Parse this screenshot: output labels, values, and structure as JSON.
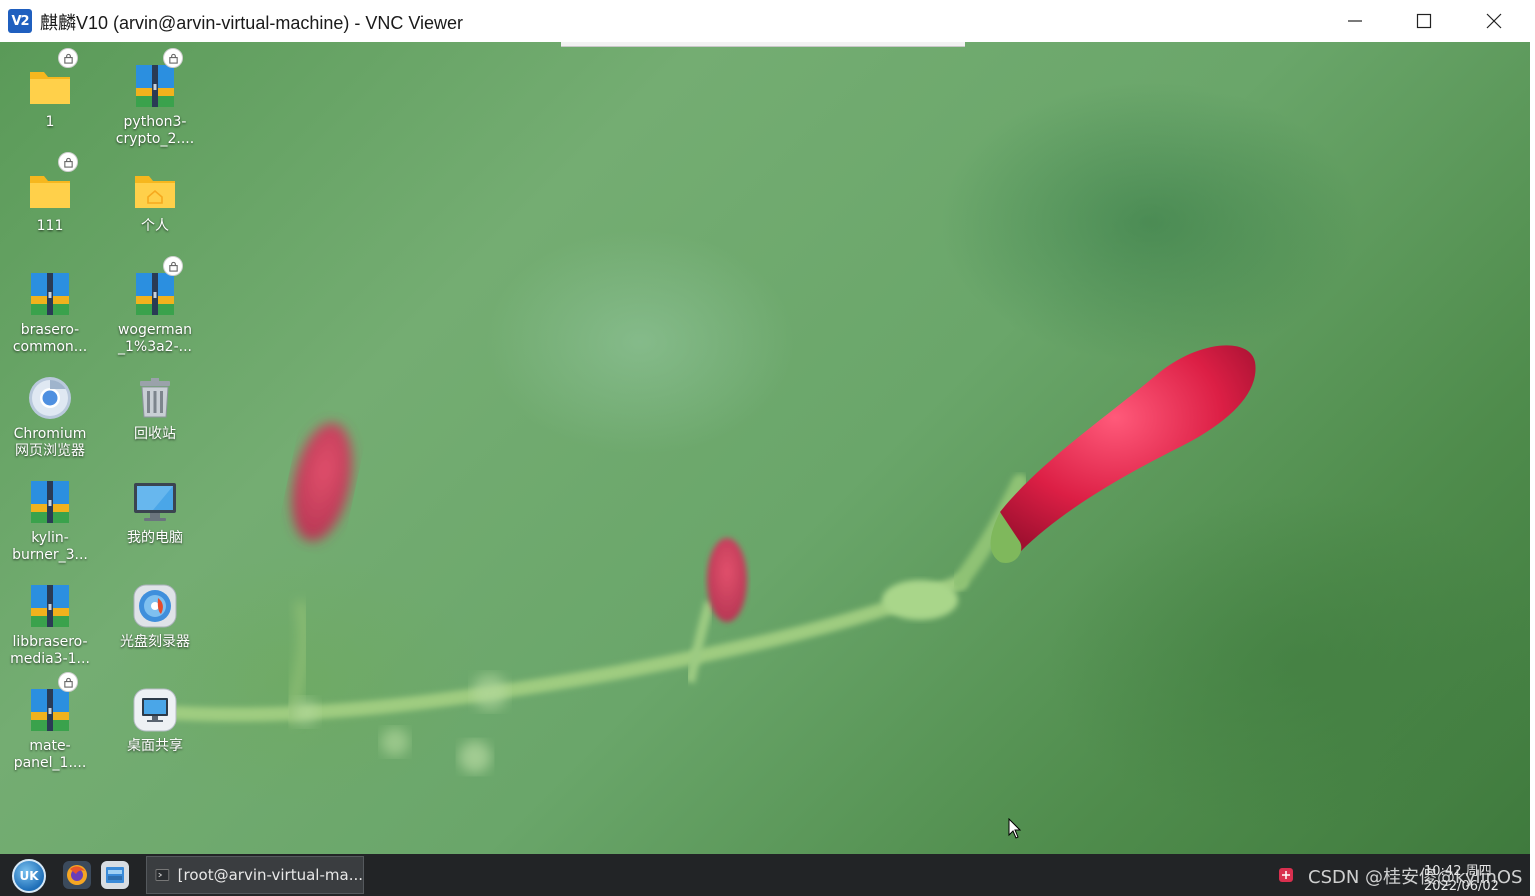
{
  "window": {
    "icon_text": "V2",
    "title": "麒麟V10 (arvin@arvin-virtual-machine) - VNC Viewer",
    "buttons": {
      "minimize": "minimize-icon",
      "maximize": "maximize-icon",
      "close": "close-icon"
    }
  },
  "desktop": {
    "icons": [
      {
        "label": "1",
        "icon": "folder-icon",
        "locked": true
      },
      {
        "label": "python3-\ncrypto_2....",
        "icon": "package-icon",
        "locked": true
      },
      {
        "label": "111",
        "icon": "folder-icon",
        "locked": true
      },
      {
        "label": "个人",
        "icon": "home-folder-icon",
        "locked": false
      },
      {
        "label": "brasero-\ncommon...",
        "icon": "package-icon",
        "locked": false
      },
      {
        "label": "wogerman\n_1%3a2-...",
        "icon": "package-icon",
        "locked": true
      },
      {
        "label": "Chromium\n网页浏览器",
        "icon": "chromium-icon",
        "locked": false
      },
      {
        "label": "回收站",
        "icon": "trash-icon",
        "locked": false
      },
      {
        "label": "kylin-\nburner_3...",
        "icon": "package-icon",
        "locked": false
      },
      {
        "label": "我的电脑",
        "icon": "computer-icon",
        "locked": false
      },
      {
        "label": "libbrasero-\nmedia3-1...",
        "icon": "package-icon",
        "locked": false
      },
      {
        "label": "光盘刻录器",
        "icon": "disc-burner-icon",
        "locked": false
      },
      {
        "label": "mate-\npanel_1....",
        "icon": "package-icon",
        "locked": true
      },
      {
        "label": "桌面共享",
        "icon": "desktop-share-icon",
        "locked": false
      }
    ]
  },
  "taskbar": {
    "start_text": "UK",
    "apps": [
      "firefox-icon",
      "file-manager-icon"
    ],
    "active_task": "[root@arvin-virtual-ma...",
    "watermark": "CSDN @桂安傻@kylinOS",
    "clock_time": "10:42 周四",
    "clock_date": "2022/06/02"
  }
}
